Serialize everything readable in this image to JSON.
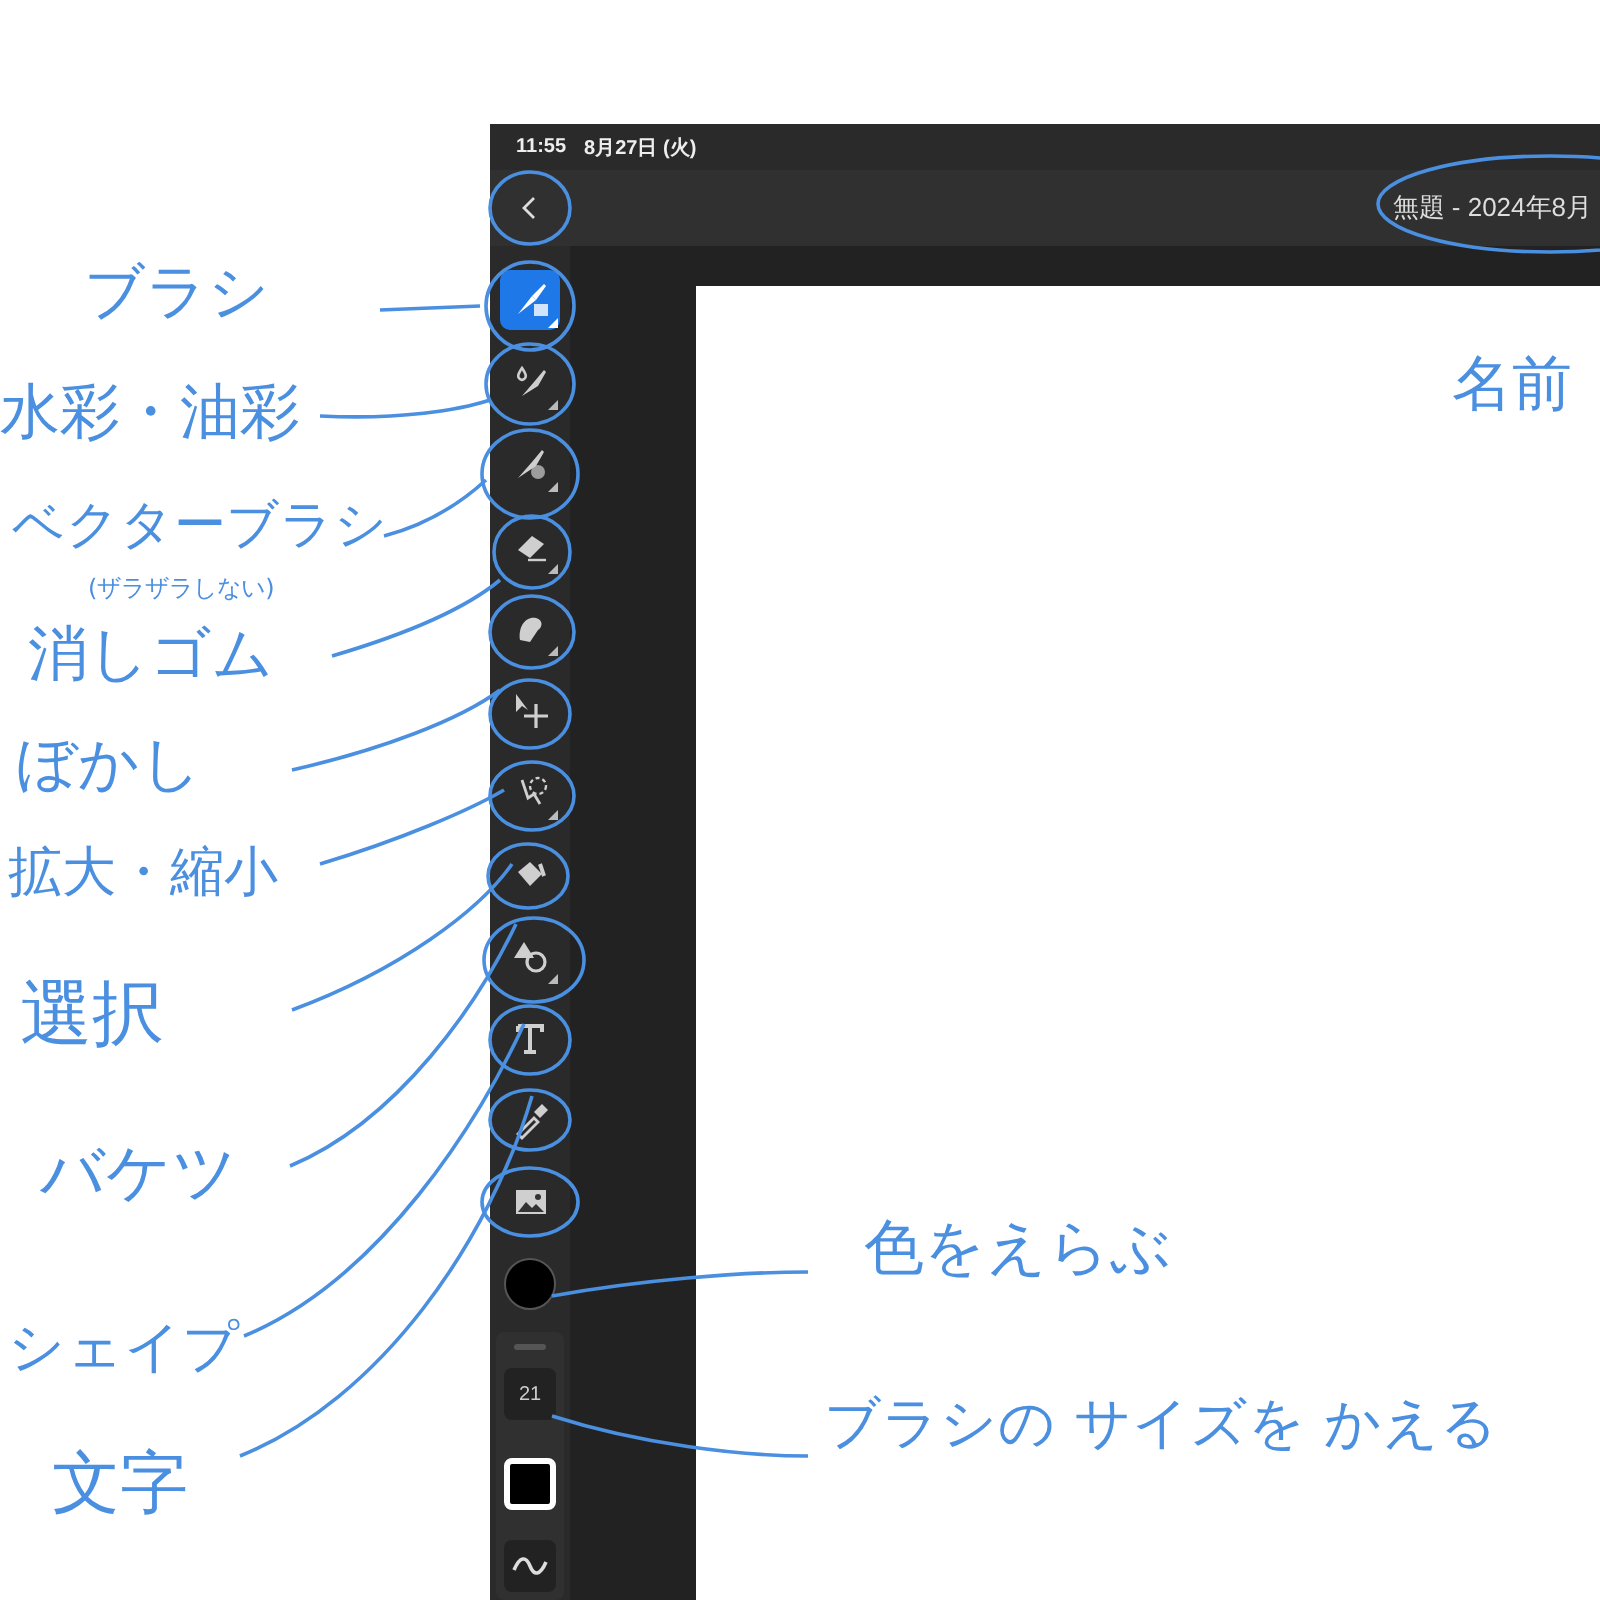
{
  "status_bar": {
    "time": "11:55",
    "date": "8月27日 (火)"
  },
  "toolbar": {
    "title": "無題 - 2024年8月"
  },
  "tools": [
    {
      "kind": "brush",
      "selected": true,
      "has_options": true
    },
    {
      "kind": "watercolor",
      "selected": false,
      "has_options": true
    },
    {
      "kind": "vector",
      "selected": false,
      "has_options": true
    },
    {
      "kind": "eraser",
      "selected": false,
      "has_options": true
    },
    {
      "kind": "smudge",
      "selected": false,
      "has_options": true
    },
    {
      "kind": "transform",
      "selected": false,
      "has_options": false
    },
    {
      "kind": "lasso",
      "selected": false,
      "has_options": true
    },
    {
      "kind": "fill",
      "selected": false,
      "has_options": false
    },
    {
      "kind": "shape",
      "selected": false,
      "has_options": true
    },
    {
      "kind": "text",
      "selected": false,
      "has_options": false
    },
    {
      "kind": "eyedropper",
      "selected": false,
      "has_options": false
    },
    {
      "kind": "image",
      "selected": false,
      "has_options": false
    }
  ],
  "brush_size": "21",
  "annotations": [
    {
      "text": "ブラシ"
    },
    {
      "text": "水彩・油彩"
    },
    {
      "text": "ベクターブラシ",
      "note": "(ザラザラしない)"
    },
    {
      "text": "消しゴム"
    },
    {
      "text": "ぼかし"
    },
    {
      "text": "拡大・縮小"
    },
    {
      "text": "選択"
    },
    {
      "text": "バケツ"
    },
    {
      "text": "シェイプ"
    },
    {
      "text": "文字"
    },
    {
      "text": "色をえらぶ"
    },
    {
      "text": "ブラシの サイズを かえる"
    },
    {
      "text": "名前"
    }
  ]
}
